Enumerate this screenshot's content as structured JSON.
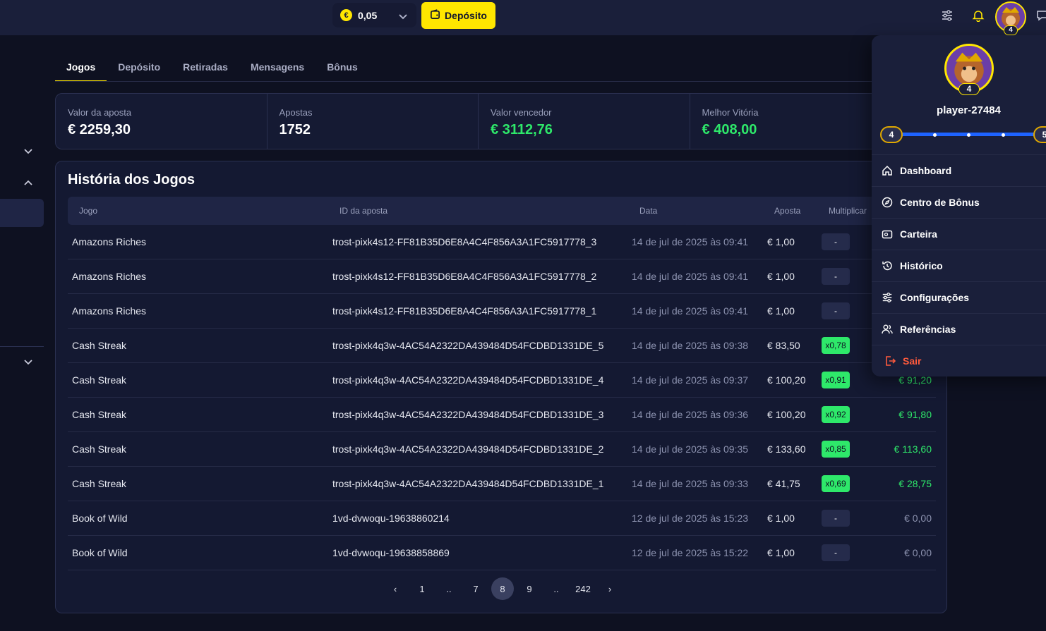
{
  "topbar": {
    "currency_symbol": "€",
    "balance": "0,05",
    "deposit_label": "Depósito",
    "level_badge": "4"
  },
  "tabs": [
    {
      "label": "Jogos",
      "active": true
    },
    {
      "label": "Depósito",
      "active": false
    },
    {
      "label": "Retiradas",
      "active": false
    },
    {
      "label": "Mensagens",
      "active": false
    },
    {
      "label": "Bônus",
      "active": false
    }
  ],
  "stats": [
    {
      "label": "Valor da aposta",
      "value": "€ 2259,30"
    },
    {
      "label": "Apostas",
      "value": "1752"
    },
    {
      "label": "Valor vencedor",
      "value": "€ 3112,76"
    },
    {
      "label": "Melhor Vitória",
      "value": "€ 408,00"
    }
  ],
  "history": {
    "title": "História dos Jogos",
    "headers": [
      "Jogo",
      "ID da aposta",
      "Data",
      "Aposta",
      "Multiplicar"
    ],
    "rows": [
      {
        "game": "Amazons Riches",
        "id": "trost-pixk4s12-FF81B35D6E8A4C4F856A3A1FC5917778_3",
        "date": "14 de jul de 2025 às 09:41",
        "bet": "€ 1,00",
        "mult": "-",
        "win": ""
      },
      {
        "game": "Amazons Riches",
        "id": "trost-pixk4s12-FF81B35D6E8A4C4F856A3A1FC5917778_2",
        "date": "14 de jul de 2025 às 09:41",
        "bet": "€ 1,00",
        "mult": "-",
        "win": ""
      },
      {
        "game": "Amazons Riches",
        "id": "trost-pixk4s12-FF81B35D6E8A4C4F856A3A1FC5917778_1",
        "date": "14 de jul de 2025 às 09:41",
        "bet": "€ 1,00",
        "mult": "-",
        "win": ""
      },
      {
        "game": "Cash Streak",
        "id": "trost-pixk4q3w-4AC54A2322DA439484D54FCDBD1331DE_5",
        "date": "14 de jul de 2025 às 09:38",
        "bet": "€ 83,50",
        "mult": "x0,78",
        "win": ""
      },
      {
        "game": "Cash Streak",
        "id": "trost-pixk4q3w-4AC54A2322DA439484D54FCDBD1331DE_4",
        "date": "14 de jul de 2025 às 09:37",
        "bet": "€ 100,20",
        "mult": "x0,91",
        "win": "€ 91,20"
      },
      {
        "game": "Cash Streak",
        "id": "trost-pixk4q3w-4AC54A2322DA439484D54FCDBD1331DE_3",
        "date": "14 de jul de 2025 às 09:36",
        "bet": "€ 100,20",
        "mult": "x0,92",
        "win": "€ 91,80"
      },
      {
        "game": "Cash Streak",
        "id": "trost-pixk4q3w-4AC54A2322DA439484D54FCDBD1331DE_2",
        "date": "14 de jul de 2025 às 09:35",
        "bet": "€ 133,60",
        "mult": "x0,85",
        "win": "€ 113,60"
      },
      {
        "game": "Cash Streak",
        "id": "trost-pixk4q3w-4AC54A2322DA439484D54FCDBD1331DE_1",
        "date": "14 de jul de 2025 às 09:33",
        "bet": "€ 41,75",
        "mult": "x0,69",
        "win": "€ 28,75"
      },
      {
        "game": "Book of Wild",
        "id": "1vd-dvwoqu-19638860214",
        "date": "12 de jul de 2025 às 15:23",
        "bet": "€ 1,00",
        "mult": "-",
        "win": "€ 0,00"
      },
      {
        "game": "Book of Wild",
        "id": "1vd-dvwoqu-19638858869",
        "date": "12 de jul de 2025 às 15:22",
        "bet": "€ 1,00",
        "mult": "-",
        "win": "€ 0,00"
      }
    ]
  },
  "pagination": {
    "prev": "‹",
    "next": "›",
    "pages": [
      "1",
      "..",
      "7",
      "8",
      "9",
      "..",
      "242"
    ],
    "current": "8"
  },
  "user_menu": {
    "username": "player-27484",
    "level": "4",
    "level_current": "4",
    "level_next": "5",
    "items": [
      {
        "label": "Dashboard",
        "icon": "home-icon"
      },
      {
        "label": "Centro de Bônus",
        "icon": "compass-icon"
      },
      {
        "label": "Carteira",
        "icon": "wallet-icon"
      },
      {
        "label": "Histórico",
        "icon": "history-icon"
      },
      {
        "label": "Configurações",
        "icon": "sliders-icon"
      },
      {
        "label": "Referências",
        "icon": "users-icon"
      }
    ],
    "logout_label": "Sair"
  },
  "colors": {
    "accent": "#ffe600",
    "win_green": "#2ee86a",
    "logout_red": "#ff5a3c",
    "level_bar": "#1e63ff"
  }
}
